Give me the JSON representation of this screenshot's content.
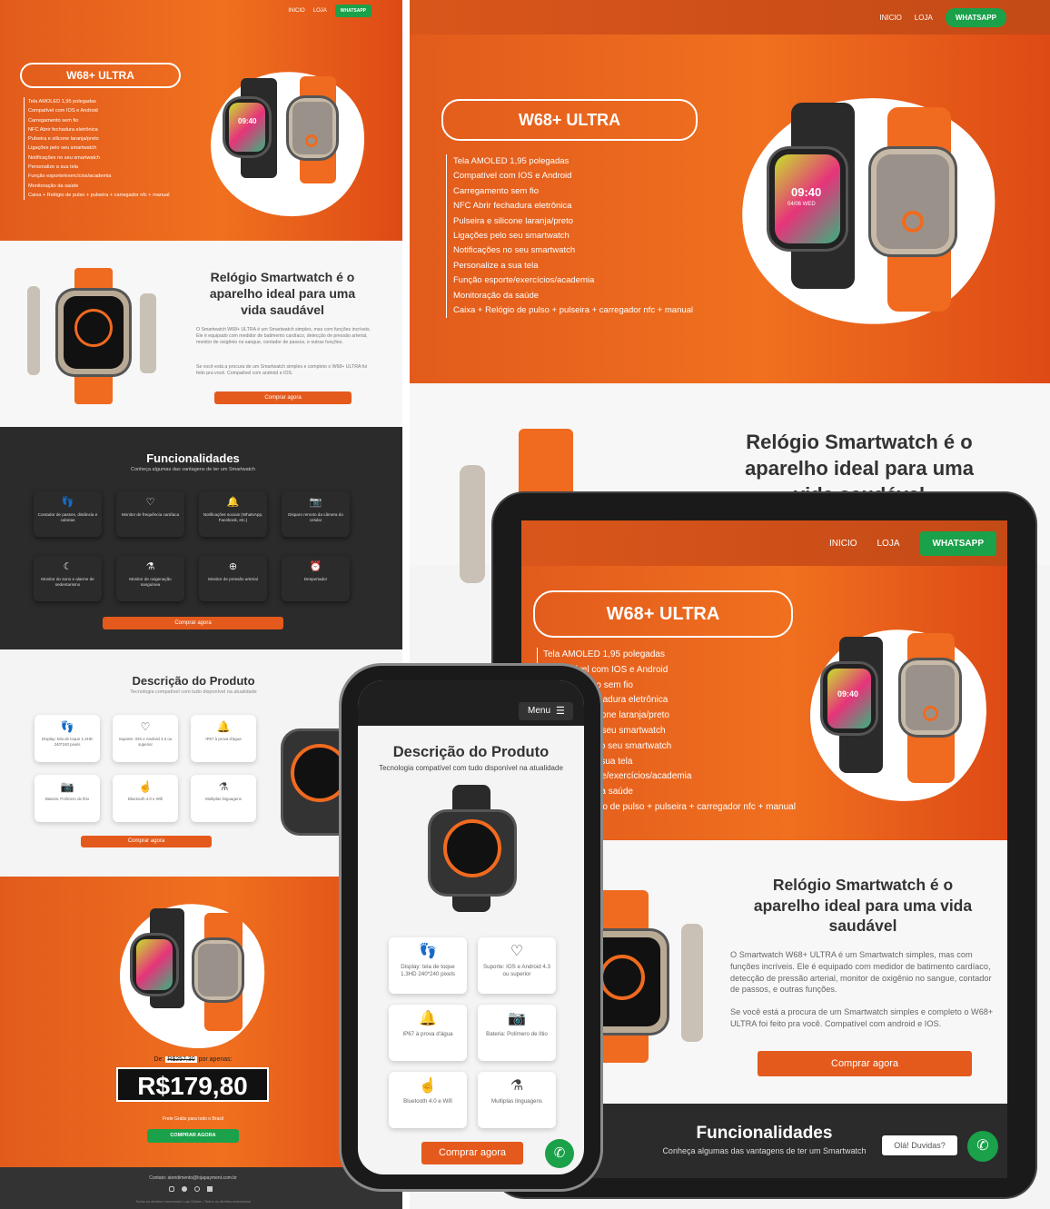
{
  "nav": {
    "home": "INICIO",
    "shop": "LOJA",
    "whatsapp": "WHATSAPP"
  },
  "hero": {
    "title": "W68+ ULTRA",
    "features": [
      "Tela AMOLED 1,95 polegadas",
      "Compatível com IOS e Android",
      "Carregamento sem fio",
      "NFC Abrir fechadura eletrônica",
      "Pulseira e silicone laranja/preto",
      "Ligações pelo seu smartwatch",
      "Notificações no seu smartwatch",
      "Personalize a sua tela",
      "Função esporte/exercícios/academia",
      "Monitoração da saúde",
      "Caixa + Relógio de pulso + pulseira + carregador nfc + manual"
    ],
    "watch_time": "09:40",
    "watch_date": "04/06 WED"
  },
  "about": {
    "heading": "Relógio Smartwatch é o aparelho ideal para uma vida saudável",
    "p1": "O Smartwatch W68+ ULTRA é um Smartwatch simples, mas com funções incríveis. Ele é equipado com medidor de batimento cardíaco, detecção de pressão arterial, monitor de oxigênio no sangue, contador de passos, e outras funções.",
    "p2": "Se você está a procura de um Smartwatch simples e completo o W68+ ULTRA foi feito pra você. Compatível com android e IOS.",
    "cta": "Comprar agora"
  },
  "features": {
    "heading": "Funcionalidades",
    "subheading": "Conheça algumas das vantagens de ter um Smartwatch",
    "items": [
      {
        "icon": "footprints-icon",
        "glyph": "👣",
        "label": "Contador de passos, distância e calorias"
      },
      {
        "icon": "heart-rate-icon",
        "glyph": "♡",
        "label": "Monitor de frequência cardíaca"
      },
      {
        "icon": "notification-icon",
        "glyph": "🔔",
        "label": "Notificações sociais (WhatsApp, Facebook, etc.)"
      },
      {
        "icon": "camera-icon",
        "glyph": "📷",
        "label": "Disparo remoto da câmera do celular"
      },
      {
        "icon": "sleep-icon",
        "glyph": "☾",
        "label": "Monitor do sono e alarme de sedentarismo"
      },
      {
        "icon": "oxygen-icon",
        "glyph": "⚗",
        "label": "Monitor de oxigenação sanguínea"
      },
      {
        "icon": "blood-pressure-icon",
        "glyph": "⊕",
        "label": "Monitor de pressão arterial"
      },
      {
        "icon": "alarm-icon",
        "glyph": "⏰",
        "label": "Despertador"
      }
    ],
    "cta": "Comprar agora"
  },
  "description": {
    "heading": "Descrição do Produto",
    "subheading": "Tecnologia compatível com tudo disponível na atualidade",
    "items": [
      {
        "icon": "footprints-icon",
        "glyph": "👣",
        "label": "Display: tela de toque 1.3HD 240*240 pixels"
      },
      {
        "icon": "heart-rate-icon",
        "glyph": "♡",
        "label": "Suporte: IOS e Android 4.3 ou superior"
      },
      {
        "icon": "water-icon",
        "glyph": "🔔",
        "label": "IP67 à prova d'água"
      },
      {
        "icon": "battery-icon",
        "glyph": "📷",
        "label": "Bateria: Polímero de lítio"
      },
      {
        "icon": "bluetooth-icon",
        "glyph": "☝",
        "label": "Bluetooth 4.0 e Wifi"
      },
      {
        "icon": "language-icon",
        "glyph": "⚗",
        "label": "Multiplas linguagens"
      }
    ],
    "cta": "Comprar agora"
  },
  "pricing": {
    "prefix": "De:",
    "old_price": "R$257,30",
    "suffix": "por apenas:",
    "price": "R$179,80",
    "shipping": "Frete Grátis para todo o Brasil",
    "cta": "COMPRAR AGORA"
  },
  "footer": {
    "contact": "Contato: atendimento@lojapayment.com.br",
    "copyright": "Todos os direitos reservados Loja Online • Todos os direitos reservados"
  },
  "phone": {
    "menu": "Menu"
  },
  "tablet": {
    "chat_tooltip": "Olá! Duvidas?"
  },
  "colors": {
    "accent": "#e45a1c",
    "whatsapp": "#1aa14a",
    "dark": "#2b2b2b"
  }
}
